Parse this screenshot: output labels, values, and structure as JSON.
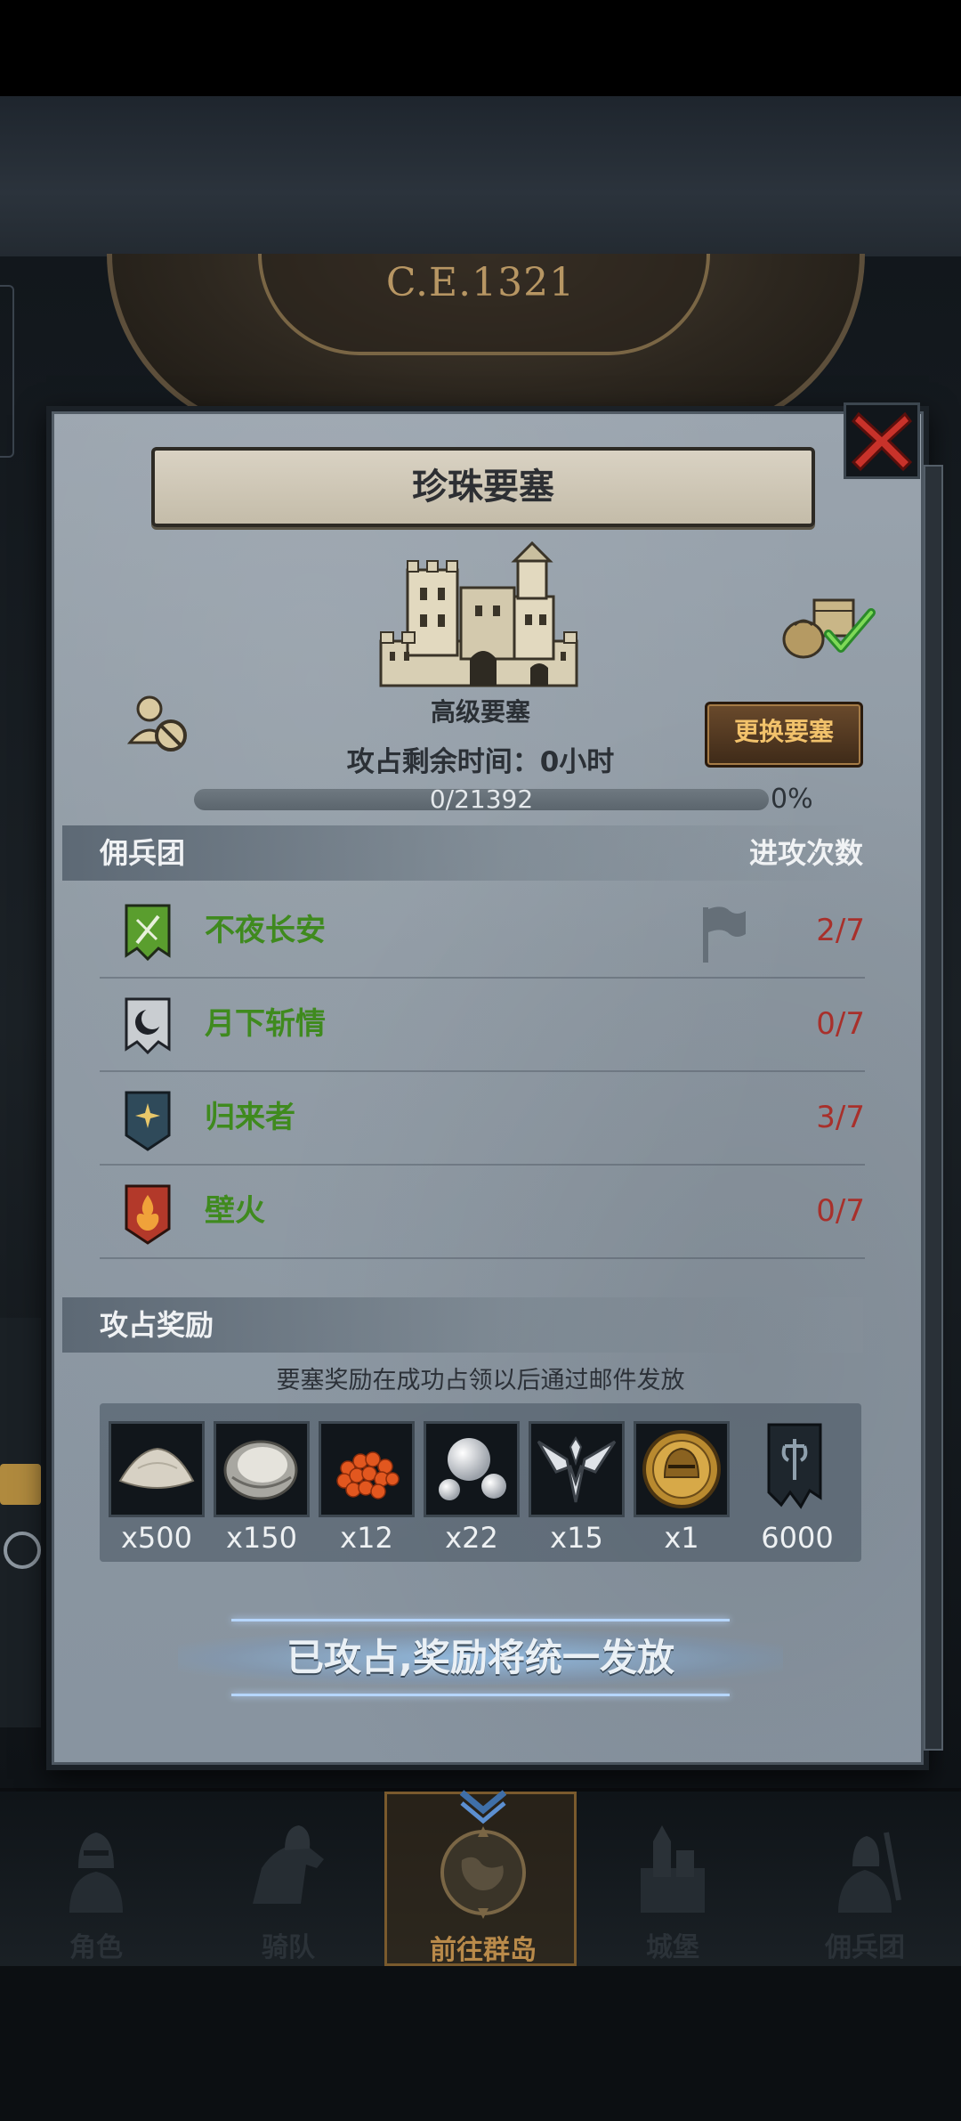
{
  "backdrop": {
    "era": "C.E.1321"
  },
  "panel": {
    "title": "珍珠要塞",
    "fortress_type": "高级要塞",
    "change_button": "更换要塞",
    "time_label": "攻占剩余时间：0小时",
    "progress": {
      "text": "0/21392",
      "percent_label": "0%",
      "fraction": 0.0
    }
  },
  "mercenary": {
    "section_label": "佣兵团",
    "attacks_label": "进攻次数",
    "rows": [
      {
        "name": "不夜长安",
        "count": "2/7",
        "color": "#5a9e2e"
      },
      {
        "name": "月下斩情",
        "count": "0/7",
        "color": "#c9cdd1"
      },
      {
        "name": "归来者",
        "count": "3/7",
        "color": "#2f4a5a"
      },
      {
        "name": "壁火",
        "count": "0/7",
        "color": "#b3392a"
      }
    ]
  },
  "rewards": {
    "section_label": "攻占奖励",
    "note": "要塞奖励在成功占领以后通过邮件发放",
    "items": [
      {
        "icon": "powder-icon",
        "qty": "x500"
      },
      {
        "icon": "oyster-icon",
        "qty": "x150"
      },
      {
        "icon": "roe-icon",
        "qty": "x12"
      },
      {
        "icon": "pearl-icon",
        "qty": "x22"
      },
      {
        "icon": "wings-emblem-icon",
        "qty": "x15"
      },
      {
        "icon": "helmet-coin-icon",
        "qty": "x1"
      },
      {
        "icon": "banner-icon",
        "qty": "6000"
      }
    ]
  },
  "action_text": "已攻占,奖励将统一发放",
  "nav": [
    {
      "label": "角色"
    },
    {
      "label": "骑队"
    },
    {
      "label": "前往群岛"
    },
    {
      "label": "城堡"
    },
    {
      "label": "佣兵团"
    }
  ]
}
